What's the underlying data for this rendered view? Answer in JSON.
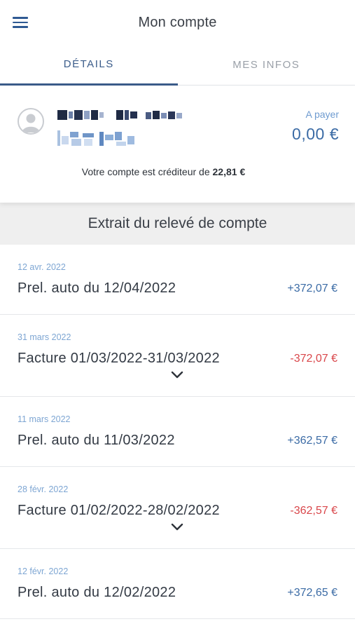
{
  "header": {
    "title": "Mon compte",
    "menu_icon": "hamburger-menu-icon"
  },
  "tabs": [
    {
      "label": "DÉTAILS",
      "active": true
    },
    {
      "label": "MES INFOS",
      "active": false
    }
  ],
  "account": {
    "avatar_icon": "user-avatar-icon",
    "pay_label": "A payer",
    "pay_amount": "0,00 €",
    "credit_prefix": "Votre compte est créditeur de",
    "credit_amount": "22,81 €"
  },
  "statement": {
    "title": "Extrait du relevé de compte",
    "rows": [
      {
        "date": "12 avr. 2022",
        "label": "Prel. auto du 12/04/2022",
        "amount": "+372,07 €",
        "sign": "positive",
        "expandable": false
      },
      {
        "date": "31 mars 2022",
        "label": "Facture 01/03/2022-31/03/2022",
        "amount": "-372,07 €",
        "sign": "negative",
        "expandable": true
      },
      {
        "date": "11 mars 2022",
        "label": "Prel. auto du 11/03/2022",
        "amount": "+362,57 €",
        "sign": "positive",
        "expandable": false
      },
      {
        "date": "28 févr. 2022",
        "label": "Facture 01/02/2022-28/02/2022",
        "amount": "-362,57 €",
        "sign": "negative",
        "expandable": true
      },
      {
        "date": "12 févr. 2022",
        "label": "Prel. auto du 12/02/2022",
        "amount": "+372,65 €",
        "sign": "positive",
        "expandable": false
      }
    ]
  },
  "colors": {
    "accent": "#3b5c8a",
    "amount_positive": "#3b6ba5",
    "amount_negative": "#d9464a",
    "date": "#7ea6d3",
    "section_bg": "#efefef"
  }
}
